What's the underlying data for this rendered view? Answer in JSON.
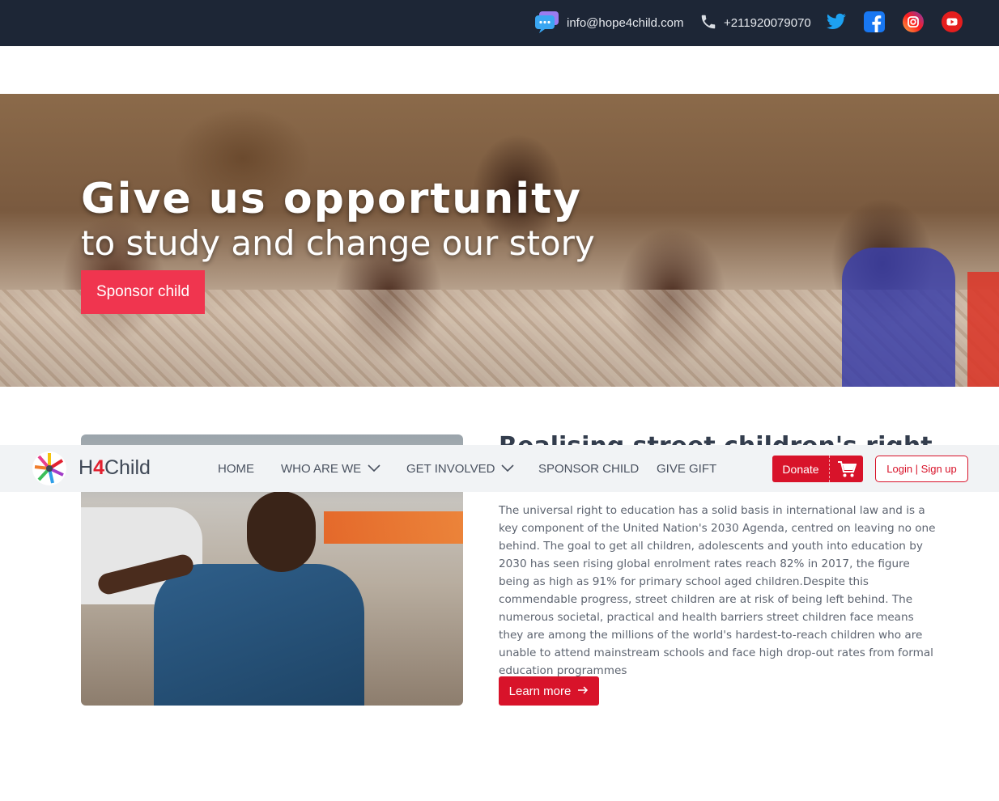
{
  "topbar": {
    "email": "info@hope4child.com",
    "phone": "+211920079070",
    "icons": [
      "chat-icon",
      "phone-icon",
      "twitter-icon",
      "facebook-icon",
      "instagram-icon",
      "youtube-icon"
    ]
  },
  "hero": {
    "title": "Give us opportunity",
    "subtitle": "to study and change our story",
    "cta_label": "Sponsor child"
  },
  "content": {
    "section_title": "Realising street children's right",
    "body": "The universal right to education has a solid basis in international law and is a key component of the United Nation's 2030 Agenda, centred on leaving no one behind. The goal to get all children, adolescents and youth into education by 2030 has seen rising global enrolment rates reach 82% in 2017, the figure being as high as 91% for primary school aged children.Despite this commendable progress, street children are at risk of being left behind. The numerous societal, practical and health barriers street children face means they are among the millions of the world's hardest-to-reach children who are unable to attend mainstream schools and face high drop-out rates from formal education programmes",
    "learn_more_label": "Learn more"
  },
  "navbar": {
    "logo_prefix": "H",
    "logo_number": "4",
    "logo_suffix": "Child",
    "items": [
      {
        "label": "HOME"
      },
      {
        "label": "WHO ARE WE"
      },
      {
        "label": "GET INVOLVED"
      },
      {
        "label": "SPONSOR CHILD"
      },
      {
        "label": "GIVE GIFT"
      }
    ],
    "donate_label": "Donate",
    "login_label": "Login | Sign up"
  },
  "colors": {
    "topbar_bg": "#1d2636",
    "accent_red": "#d8132a",
    "hero_button": "#f0354f",
    "navbar_bg": "#f1f3f5"
  }
}
